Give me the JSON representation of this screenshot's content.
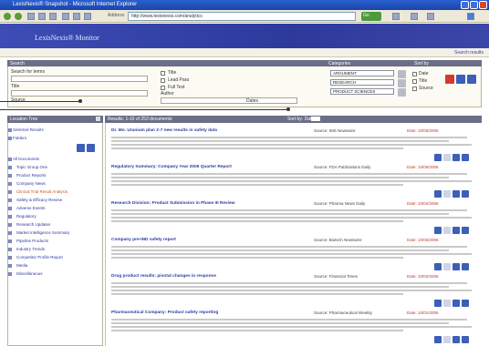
{
  "window": {
    "title": "LexisNexis® Snapshot - Microsoft Internet Explorer",
    "address_label": "Address",
    "address": "http://www.lexisnexis.com/analytics",
    "go_label": "Go"
  },
  "app": {
    "logo": "LexisNexis® Monitor",
    "top_link": "Search results"
  },
  "search": {
    "header": "Search",
    "header2": "Categories",
    "header3": "Sort by",
    "fields": [
      {
        "label": "Search for terms"
      },
      {
        "label": "Title"
      },
      {
        "label": "Source"
      },
      {
        "label": "Author"
      }
    ],
    "checks": [
      "Title",
      "Lead Para",
      "Full Text",
      "Dates"
    ],
    "categories": [
      "ARGUMENT",
      "RESEARCH",
      "PRODUCT SCIENCES"
    ],
    "sort_options": [
      "Date",
      "Title",
      "Source"
    ]
  },
  "left_nav": {
    "header": "Location Tree",
    "top_items": [
      "Selected Results",
      "Folders"
    ],
    "tree": [
      "All Documents",
      "Topic Group One",
      "Product Reports",
      "Company News",
      "Clinical Trial Result Analysis",
      "Safety & Efficacy Review",
      "Adverse Events",
      "Regulatory",
      "Research Updates",
      "Market Intelligence Summary",
      "Pipeline Products",
      "Industry Trends",
      "Competitor Profile Report",
      "Media",
      "Miscellaneous"
    ]
  },
  "results": {
    "header": "Results: 1-10 of 253 documents",
    "sort_label": "Sort by: Date",
    "items": [
      {
        "title": "Dr. Mo. Uranium plan 2-7 new results in safety data",
        "source": "Source: IMS Newswire",
        "date": "Date: 10/06/2006"
      },
      {
        "title": "Regulatory Summary: Company Year 2006 Quarter Report",
        "source": "Source: FDA Publications Daily",
        "date": "Date: 10/05/2006"
      },
      {
        "title": "Research Division: Product Submission in Phase III Review",
        "source": "Source: Pharma News Daily",
        "date": "Date: 10/04/2006"
      },
      {
        "title": "Company pre-IND safety report",
        "source": "Source: Biotech Newswire",
        "date": "Date: 10/03/2006"
      },
      {
        "title": "Drug product results: pivotal changes in response",
        "source": "Source: Financial Times",
        "date": "Date: 10/02/2006"
      },
      {
        "title": "Pharmaceutical Company: Product safety reporting",
        "source": "Source: Pharmaceutical Weekly",
        "date": "Date: 10/01/2006"
      }
    ]
  },
  "colors": {
    "accent": "#2d3a9c",
    "panel_head": "#6b6e86",
    "link": "#2b3aa0",
    "date": "#c0392b"
  }
}
